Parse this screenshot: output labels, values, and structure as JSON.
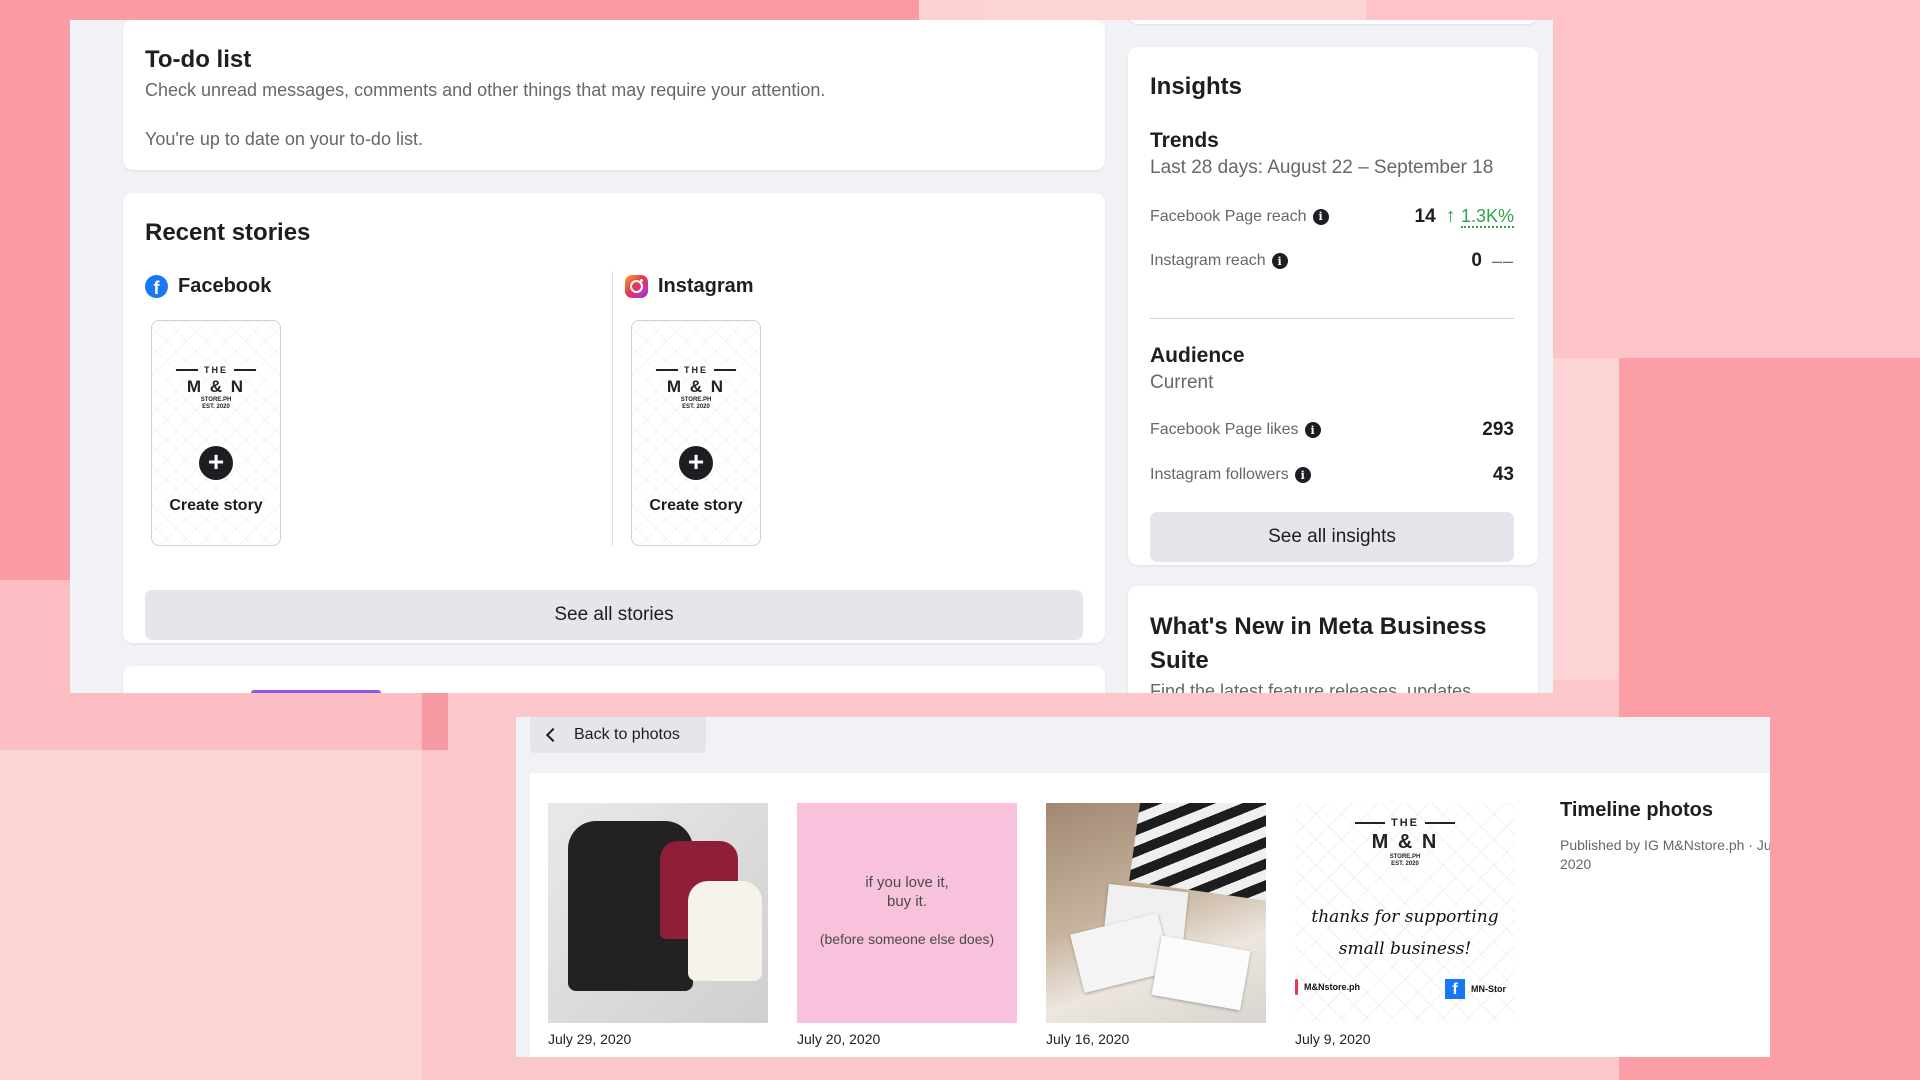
{
  "colors": {
    "facebook_blue": "#1877f2",
    "trend_green": "#31a24c",
    "background_pink": "#fcd4d6",
    "accent_pink": "#fb9ca4"
  },
  "todo": {
    "title": "To-do list",
    "description": "Check unread messages, comments and other things that may require your attention.",
    "status": "You're up to date on your to-do list."
  },
  "stories": {
    "title": "Recent stories",
    "platforms": [
      {
        "name": "Facebook",
        "icon": "facebook-icon",
        "action": "Create story"
      },
      {
        "name": "Instagram",
        "icon": "instagram-icon",
        "action": "Create story"
      }
    ],
    "see_all": "See all stories"
  },
  "brand_logo": {
    "the": "THE",
    "name": "M & N",
    "sub": "STORE.PH",
    "est": "EST. 2020"
  },
  "insights": {
    "title": "Insights",
    "trends": {
      "heading": "Trends",
      "period": "Last 28 days: August 22 – September 18",
      "metrics": [
        {
          "label": "Facebook Page reach",
          "value": "14",
          "change": "1.3K%",
          "trend": "up"
        },
        {
          "label": "Instagram reach",
          "value": "0",
          "change": "––",
          "trend": "none"
        }
      ]
    },
    "audience": {
      "heading": "Audience",
      "period": "Current",
      "metrics": [
        {
          "label": "Facebook Page likes",
          "value": "293"
        },
        {
          "label": "Instagram followers",
          "value": "43"
        }
      ]
    },
    "see_all": "See all insights"
  },
  "whats_new": {
    "title": "What's New in Meta Business Suite",
    "description": "Find the latest feature releases, updates"
  },
  "photos": {
    "back_label": "Back to photos",
    "items": [
      {
        "date": "July 29, 2020"
      },
      {
        "date": "July 20, 2020",
        "text_line1": "if you love it,",
        "text_line2": "buy it.",
        "text_line3": "(before someone else does)"
      },
      {
        "date": "July 16, 2020"
      },
      {
        "date": "July 9, 2020",
        "script_line1": "thanks for supporting",
        "script_line2": "small business!",
        "ig_handle": "M&Nstore.ph",
        "fb_handle": "MN-Stor"
      }
    ],
    "album": {
      "title": "Timeline photos",
      "meta_line1": "Published by IG M&Nstore.ph · July",
      "meta_line2": "2020"
    }
  }
}
